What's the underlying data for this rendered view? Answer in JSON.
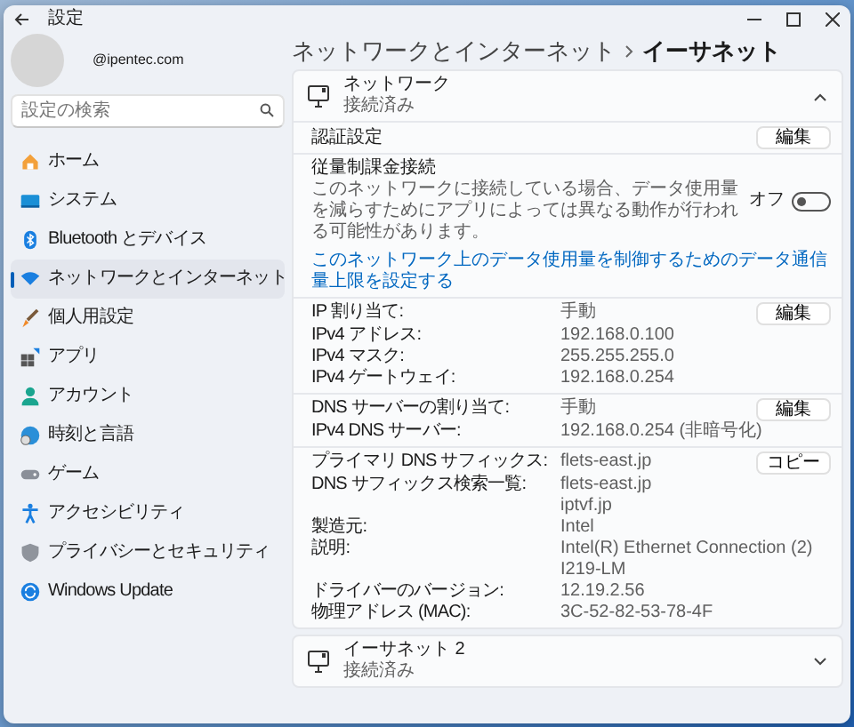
{
  "window": {
    "title": "設定"
  },
  "account": {
    "email": "@ipentec.com"
  },
  "search": {
    "placeholder": "設定の検索"
  },
  "sidebar": {
    "items": [
      {
        "label": "ホーム",
        "selected": false
      },
      {
        "label": "システム",
        "selected": false
      },
      {
        "label": "Bluetooth とデバイス",
        "selected": false
      },
      {
        "label": "ネットワークとインターネット",
        "selected": true
      },
      {
        "label": "個人用設定",
        "selected": false
      },
      {
        "label": "アプリ",
        "selected": false
      },
      {
        "label": "アカウント",
        "selected": false
      },
      {
        "label": "時刻と言語",
        "selected": false
      },
      {
        "label": "ゲーム",
        "selected": false
      },
      {
        "label": "アクセシビリティ",
        "selected": false
      },
      {
        "label": "プライバシーとセキュリティ",
        "selected": false
      },
      {
        "label": "Windows Update",
        "selected": false
      }
    ]
  },
  "breadcrumb": [
    "ネットワークとインターネット",
    "イーサネット"
  ],
  "panels": [
    {
      "title": "ネットワーク",
      "status": "接続済み",
      "expanded": true,
      "sections": [
        {
          "kind": "setting",
          "label": "認証設定",
          "button": "編集"
        },
        {
          "kind": "metered",
          "title": "従量制課金接続",
          "description": "このネットワークに接続している場合、データ使用量を減らすためにアプリによっては異なる動作が行われる可能性があります。",
          "state_label": "オフ",
          "on": false,
          "link": "このネットワーク上のデータ使用量を制御するためのデータ通信量上限を設定する"
        },
        {
          "kind": "properties",
          "button": "編集",
          "rows": [
            {
              "label": "IP 割り当て:",
              "values": [
                "手動"
              ]
            },
            {
              "label": "IPv4 アドレス:",
              "values": [
                "192.168.0.100"
              ]
            },
            {
              "label": "IPv4 マスク:",
              "values": [
                "255.255.255.0"
              ]
            },
            {
              "label": "IPv4 ゲートウェイ:",
              "values": [
                "192.168.0.254"
              ]
            }
          ]
        },
        {
          "kind": "properties",
          "button": "編集",
          "rows": [
            {
              "label": "DNS サーバーの割り当て:",
              "values": [
                "手動"
              ]
            },
            {
              "label": "IPv4 DNS サーバー:",
              "values": [
                "192.168.0.254 (非暗号化)"
              ]
            }
          ]
        },
        {
          "kind": "properties",
          "button": "コピー",
          "rows": [
            {
              "label": "プライマリ DNS サフィックス:",
              "values": [
                "flets-east.jp"
              ]
            },
            {
              "label": "DNS サフィックス検索一覧:",
              "values": [
                "flets-east.jp",
                "iptvf.jp"
              ]
            },
            {
              "label": "製造元:",
              "values": [
                "Intel"
              ]
            },
            {
              "label": "説明:",
              "values": [
                "Intel(R) Ethernet Connection (2)",
                "I219-LM"
              ]
            },
            {
              "label": "ドライバーのバージョン:",
              "values": [
                "12.19.2.56"
              ]
            },
            {
              "label": "物理アドレス (MAC):",
              "values": [
                "3C-52-82-53-78-4F"
              ]
            }
          ]
        }
      ]
    },
    {
      "title": "イーサネット 2",
      "status": "接続済み",
      "expanded": false
    }
  ]
}
